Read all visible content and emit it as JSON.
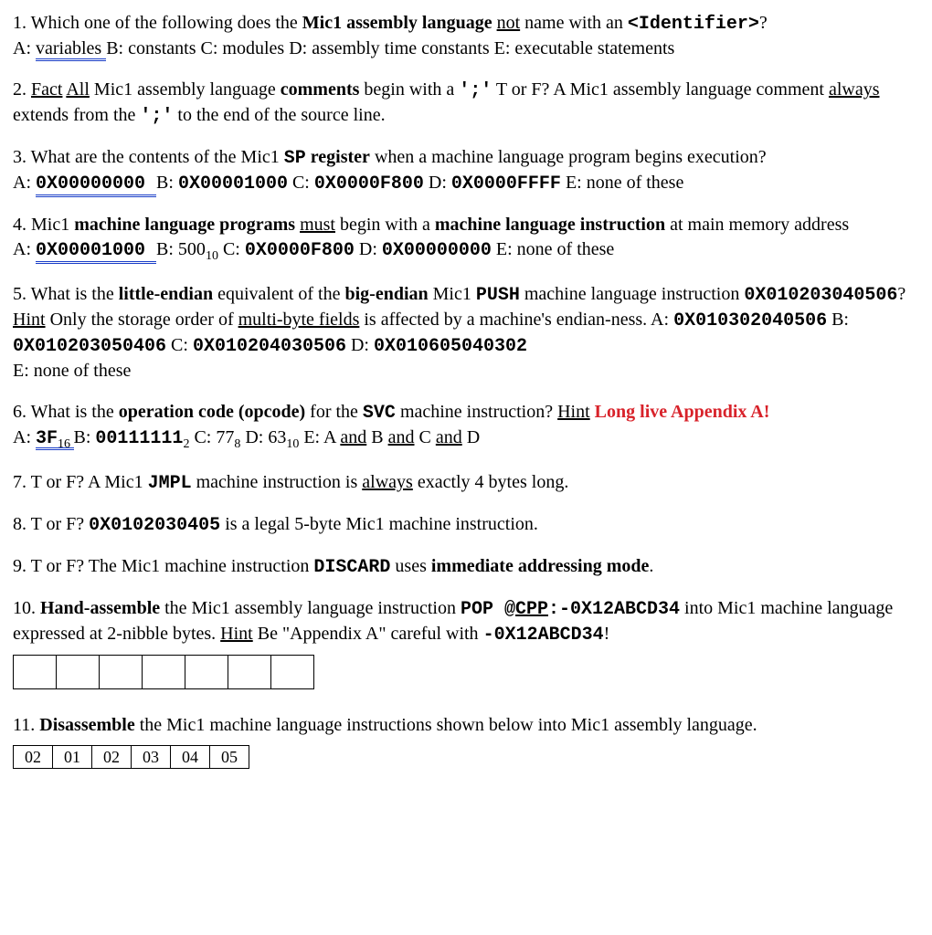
{
  "q1": {
    "num": "1.",
    "t1": " Which one of the following does the ",
    "t2": "Mic1 assembly language",
    "t3": " ",
    "t4": "not",
    "t5": " name with an ",
    "t6": "<Identifier>",
    "t7": "?",
    "a": "A: ",
    "a_ans": "variables ",
    "b": " B: constants  C: modules  D: assembly time constants  E: executable statements"
  },
  "q2": {
    "num": "2.",
    "t1": " ",
    "fact": "Fact",
    "t2": " ",
    "all": "All",
    "t3": " Mic1 assembly language ",
    "t4": "comments",
    "t5": " begin with a ",
    "semi1": "';'",
    "t6": " T or F? A Mic1 assembly language comment ",
    "always": "always",
    "t7": " extends from the ",
    "semi2": "';'",
    "t8": " to the end of the source line."
  },
  "q3": {
    "num": "3.",
    "t1": " What are the contents of the Mic1 ",
    "sp": "SP",
    "t2": " register",
    "t3": " when a machine language program begins execution?",
    "a": "A: ",
    "a_ans": "0X00000000 ",
    "b": " B: ",
    "bv": "0X00001000",
    "c": "  C: ",
    "cv": "0X0000F800",
    "d": "  D: ",
    "dv": "0X0000FFFF",
    "e": "  E: none of these"
  },
  "q4": {
    "num": "4.",
    "t1": " Mic1 ",
    "t2": "machine language programs",
    "t3": " ",
    "must": "must",
    "t4": " begin with a ",
    "t5": "machine language instruction",
    "t6": " at main memory address",
    "a": "A: ",
    "a_ans": "0X00001000 ",
    "b": " B: 500",
    "bsub": "10",
    "c": "  C: ",
    "cv": "0X0000F800",
    "d": "  D: ",
    "dv": "0X00000000",
    "e": "  E: none of these"
  },
  "q5": {
    "num": "5.",
    "t1": " What is the ",
    "t2": "little-endian",
    "t3": " equivalent of the ",
    "t4": "big-endian",
    "t5": " Mic1 ",
    "push": "PUSH",
    "t6": " machine language instruction ",
    "code1": "0X010203040506",
    "t7": "? ",
    "hint": "Hint",
    "t8": " Only the storage order of ",
    "multi": "multi-byte fields",
    "t9": " is affected by a machine's endian-ness.  A: ",
    "av": "0X010302040506",
    "b": "  B: ",
    "bv": "0X010203050406",
    "c": "  C: ",
    "cv": "0X010204030506",
    "d": "  D: ",
    "dv": "0X010605040302",
    "e": "E: none of these"
  },
  "q6": {
    "num": "6.",
    "t1": " What is the ",
    "t2": "operation code (opcode)",
    "t3": " for the ",
    "svc": "SVC",
    "t4": " machine instruction? ",
    "hint": "Hint",
    "t5": " ",
    "red": "Long live Appendix A!",
    "a": "A: ",
    "av1": "3F",
    "asub": "16 ",
    "b": " B: ",
    "bv": "00111111",
    "bsub": "2",
    "c": "  C: 77",
    "csub": "8",
    "d": "  D: 63",
    "dsub": "10",
    "e": "  E: A ",
    "and1": "and",
    "e2": " B ",
    "and2": "and",
    "e3": " C ",
    "and3": "and",
    "e4": " D"
  },
  "q7": {
    "num": "7.",
    "t1": " T or F? A Mic1 ",
    "jmpl": "JMPL",
    "t2": " machine instruction is ",
    "always": "always",
    "t3": " exactly 4 bytes long."
  },
  "q8": {
    "num": "8.",
    "t1": " T or F? ",
    "code": "0X0102030405",
    "t2": " is a legal 5-byte Mic1 machine instruction."
  },
  "q9": {
    "num": "9.",
    "t1": " T or F? The Mic1 machine instruction ",
    "disc": "DISCARD",
    "t2": " uses ",
    "imm": "immediate addressing mode",
    "t3": "."
  },
  "q10": {
    "num": "10.",
    "t1": " ",
    "t2": "Hand-assemble",
    "t3": " the Mic1 assembly language instruction ",
    "pop": "POP  ",
    "at": "@",
    "cpp": "CPP",
    "rest": ":-0X12ABCD34",
    "t4": " into Mic1 machine language expressed at 2-nibble bytes. ",
    "hint": "Hint",
    "t5": " Be \"Appendix A\" careful with ",
    "neg": "-0X12ABCD34",
    "t6": "!",
    "boxes": [
      "",
      "",
      "",
      "",
      "",
      "",
      ""
    ]
  },
  "q11": {
    "num": "11.",
    "t1": " ",
    "t2": "Disassemble",
    "t3": " the Mic1 machine language instructions shown below into Mic1 assembly language.",
    "boxes": [
      "02",
      "01",
      "02",
      "03",
      "04",
      "05"
    ]
  }
}
